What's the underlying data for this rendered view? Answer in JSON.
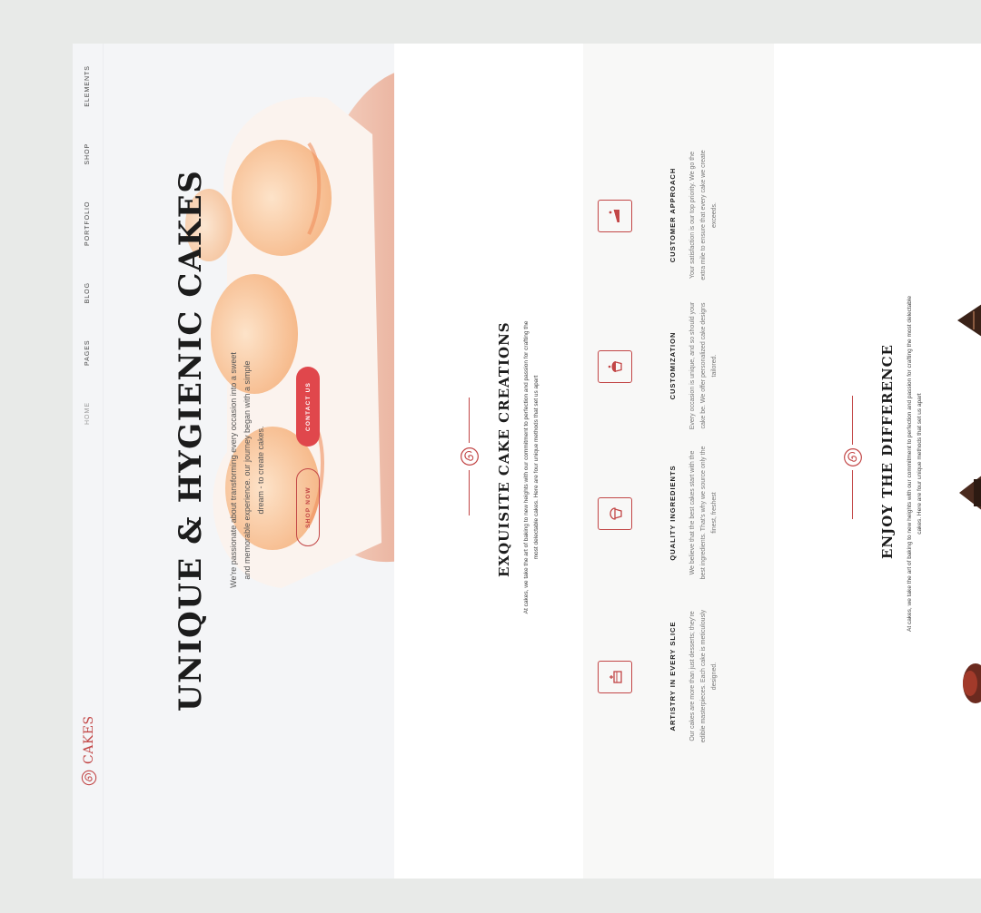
{
  "brand": {
    "name": "CAKES"
  },
  "nav": {
    "items": [
      {
        "label": "HOME",
        "active": true
      },
      {
        "label": "PAGES"
      },
      {
        "label": "BLOG"
      },
      {
        "label": "PORTFOLIO"
      },
      {
        "label": "SHOP"
      },
      {
        "label": "ELEMENTS"
      }
    ]
  },
  "hero": {
    "title": "UNIQUE & HYGIENIC CAKES",
    "description": "We're passionate about transforming every occasion into a sweet and memorable experience. our journey began with a simple dream - to create cakes.",
    "shop_button": "SHOP NOW",
    "contact_button": "CONTACT US"
  },
  "creations": {
    "title": "EXQUISITE CAKE CREATIONS",
    "description": "At cakes, we take the art of baking to new heights with our commitment to perfection and passion for crafting the most delectable cakes. Here are four unique methods that set us apart"
  },
  "features": [
    {
      "icon": "cake-icon",
      "title": "ARTISTRY IN EVERY SLICE",
      "text": "Our cakes are more than just desserts; they're edible masterpieces. Each cake is meticulously designed."
    },
    {
      "icon": "cupcake-icon",
      "title": "QUALITY INGREDIENTS",
      "text": "We believe that the best cakes start with the best ingredients. That's why we source only the finest, freshest"
    },
    {
      "icon": "muffin-icon",
      "title": "CUSTOMIZATION",
      "text": "Every occasion is unique, and so should your cake be. We offer personalized cake designs tailored."
    },
    {
      "icon": "cake-slice-icon",
      "title": "CUSTOMER APPROACH",
      "text": "Your satisfaction is our top priority. We go the extra mile to ensure that every cake we create exceeds."
    }
  ],
  "difference": {
    "title": "ENJOY THE DIFFERENCE",
    "description": "At cakes, we take the art of baking to new heights with our commitment to perfection and passion for crafting the most delectable cakes. Here are four unique methods that set us apart"
  },
  "colors": {
    "accent": "#c24646",
    "button": "#e0474c",
    "background": "#e8eae8"
  }
}
